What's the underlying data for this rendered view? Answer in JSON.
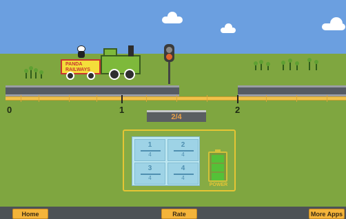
{
  "scene": {
    "wagon_label": "PANDA RAILWAYS",
    "fraction_display": "2/4",
    "ticks": [
      "0",
      "1",
      "2"
    ],
    "power_label": "POWER",
    "battery_level": 3
  },
  "cards": [
    {
      "numerator": "1",
      "denominator": "4"
    },
    {
      "numerator": "2",
      "denominator": "4"
    },
    {
      "numerator": "3",
      "denominator": "4"
    },
    {
      "numerator": "4",
      "denominator": "4"
    }
  ],
  "buttons": {
    "home": "Home",
    "rate": "Rate",
    "more_apps": "More Apps"
  },
  "colors": {
    "sky": "#6b9fe0",
    "grass": "#7fa640",
    "accent": "#f4b43a",
    "fraction_text": "#e8a04a"
  }
}
